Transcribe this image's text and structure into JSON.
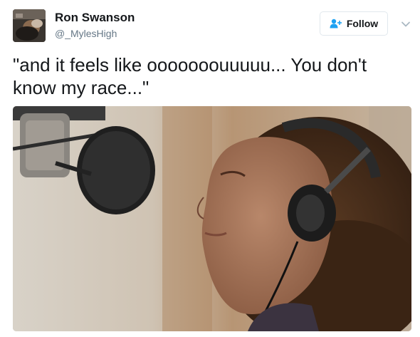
{
  "user": {
    "display_name": "Ron Swanson",
    "handle": "@_MylesHigh"
  },
  "follow_button": {
    "label": "Follow",
    "icon": "add-user-icon",
    "accent": "#1da1f2"
  },
  "menu": {
    "icon": "chevron-down-icon"
  },
  "tweet": {
    "text": "\"and it feels like ooooooouuuuu... You don't know my race...\""
  },
  "media": {
    "icon": "photo"
  }
}
